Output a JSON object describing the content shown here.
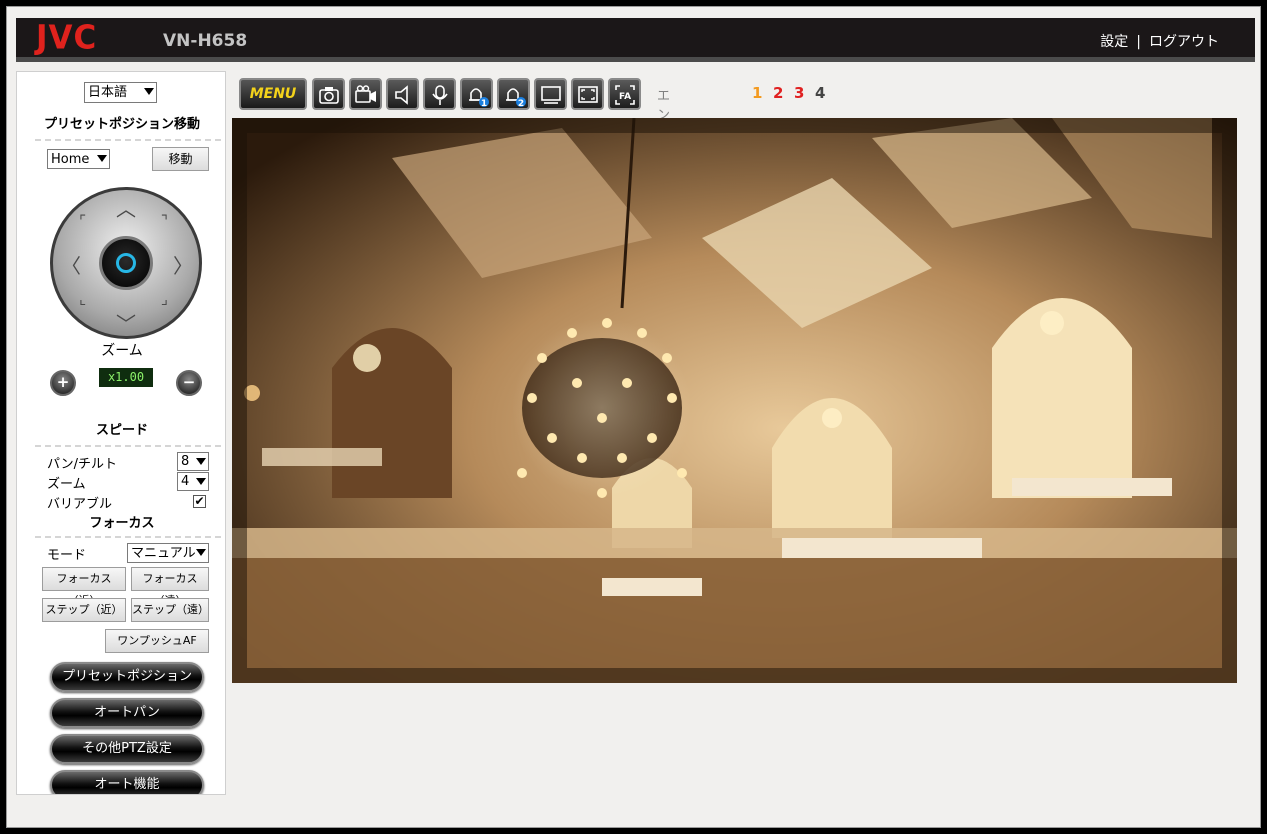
{
  "header": {
    "brand": "JVC",
    "model": "VN-H658",
    "settings_link": "設定",
    "separator": "|",
    "logout_link": "ログアウト"
  },
  "sidebar": {
    "language": "日本語",
    "preset_move_title": "プリセットポジション移動",
    "preset_select": "Home",
    "move_button": "移動",
    "zoom_title": "ズーム",
    "zoom_in_symbol": "+",
    "zoom_out_symbol": "−",
    "zoom_value": "x1.00",
    "speed_title": "スピード",
    "speed": {
      "pan_tilt_label": "パン/チルト",
      "pan_tilt_value": "8",
      "zoom_label": "ズーム",
      "zoom_value": "4",
      "variable_label": "バリアブル",
      "variable_checked": "✔"
    },
    "focus_title": "フォーカス",
    "focus": {
      "mode_label": "モード",
      "mode_value": "マニュアル",
      "focus_near": "フォーカス（近）",
      "focus_far": "フォーカス（遠）",
      "step_near": "ステップ（近）",
      "step_far": "ステップ（遠）",
      "one_push_af": "ワンプッシュAF"
    },
    "pills": [
      "プリセットポジション",
      "オートパン",
      "その他PTZ設定",
      "オート機能"
    ]
  },
  "toolbar": {
    "menu_label": "MENU",
    "icons": [
      "snapshot-icon",
      "record-icon",
      "speaker-icon",
      "microphone-icon",
      "alarm-1-icon",
      "alarm-2-icon",
      "screen-icon",
      "fit-screen-icon",
      "fa-icon"
    ],
    "alarm_1_badge": "1",
    "alarm_2_badge": "2",
    "fa_label": "FA",
    "encoder_label": "エンコーダー",
    "encoders": [
      "1",
      "2",
      "3",
      "4"
    ]
  },
  "colors": {
    "brand_red": "#e0221d",
    "encoder_1": "#f39a1f",
    "encoder_2": "#e02020",
    "encoder_3": "#e02020",
    "encoder_4": "#444444",
    "zoom_display": "#8cf26a"
  }
}
